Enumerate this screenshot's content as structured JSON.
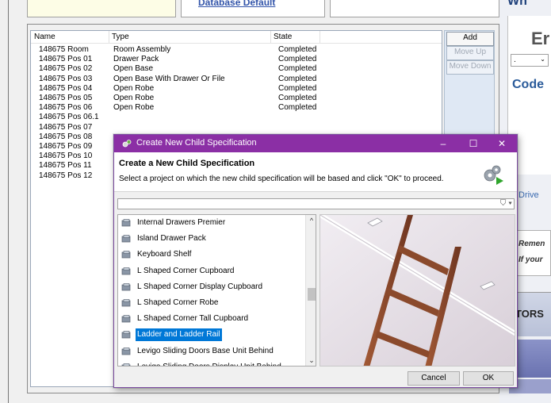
{
  "background_window": {
    "top_link": "Database Default",
    "list_headers": [
      "Name",
      "Type",
      "State"
    ],
    "rows": [
      {
        "name": "148675  Room",
        "type": "Room Assembly",
        "state": "Completed"
      },
      {
        "name": "148675 Pos 01",
        "type": "Drawer Pack",
        "state": "Completed"
      },
      {
        "name": "148675 Pos 02",
        "type": "Open Base",
        "state": "Completed"
      },
      {
        "name": "148675 Pos 03",
        "type": "Open Base With Drawer Or File",
        "state": "Completed"
      },
      {
        "name": "148675 Pos 04",
        "type": "Open Robe",
        "state": "Completed"
      },
      {
        "name": "148675 Pos 05",
        "type": "Open Robe",
        "state": "Completed"
      },
      {
        "name": "148675 Pos 06",
        "type": "Open Robe",
        "state": "Completed"
      },
      {
        "name": "148675 Pos 06.1",
        "type": "",
        "state": ""
      },
      {
        "name": "148675 Pos 07",
        "type": "",
        "state": ""
      },
      {
        "name": "148675 Pos 08",
        "type": "",
        "state": ""
      },
      {
        "name": "148675 Pos 09",
        "type": "",
        "state": ""
      },
      {
        "name": "148675 Pos 10",
        "type": "",
        "state": ""
      },
      {
        "name": "148675 Pos 11",
        "type": "",
        "state": ""
      },
      {
        "name": "148675 Pos 12",
        "type": "",
        "state": ""
      }
    ],
    "buttons": {
      "add": "Add",
      "move_up": "Move Up",
      "move_down": "Move Down"
    },
    "right_panel": {
      "top_text": "Wh",
      "heading": "Er",
      "dropdown_value": ".",
      "code_label": "Code",
      "drive_label": "Drive",
      "reminder_line1": "Remen",
      "reminder_line2": "If your",
      "tors_label": "TORS"
    }
  },
  "dialog": {
    "title": "Create New Child Specification",
    "heading": "Create a New Child Specification",
    "instruction": "Select a project on which the new child specification will be based and click \"OK\" to proceed.",
    "filter_value": "",
    "items": [
      {
        "label": "Internal Drawers Premier",
        "selected": false
      },
      {
        "label": "Island Drawer Pack",
        "selected": false
      },
      {
        "label": "Keyboard Shelf",
        "selected": false
      },
      {
        "label": "L Shaped Corner Cupboard",
        "selected": false
      },
      {
        "label": "L Shaped Corner Display Cupboard",
        "selected": false
      },
      {
        "label": "L Shaped Corner Robe",
        "selected": false
      },
      {
        "label": "L Shaped Corner Tall Cupboard",
        "selected": false
      },
      {
        "label": "Ladder and Ladder Rail",
        "selected": true
      },
      {
        "label": "Levigo Sliding Doors Base Unit Behind",
        "selected": false
      },
      {
        "label": "Levigo Sliding Doors Display Unit Behind",
        "selected": false
      }
    ],
    "cancel_label": "Cancel",
    "ok_label": "OK",
    "window_controls": {
      "minimize": "–",
      "maximize": "☐",
      "close": "✕"
    },
    "colors": {
      "title_bar": "#8b2fa5",
      "selection": "#0078d7",
      "ladder": "#8b4a2c"
    }
  }
}
